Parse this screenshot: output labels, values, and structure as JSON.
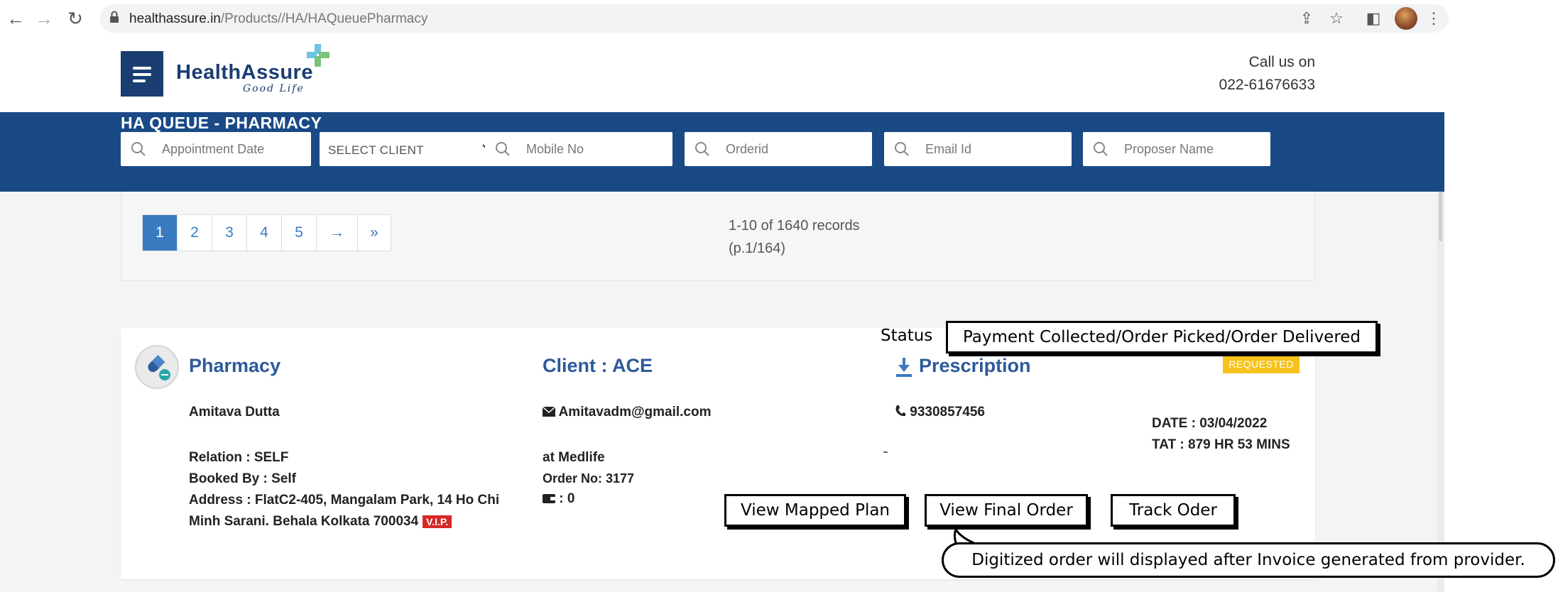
{
  "browser": {
    "url_host": "healthassure.in",
    "url_path": "/Products//HA/HAQueuePharmacy",
    "back_icon": "←",
    "forward_icon": "→",
    "reload_icon": "↻",
    "share_icon": "⇪",
    "star_icon": "☆",
    "sidepanel_icon": "◧",
    "more_icon": "⋮"
  },
  "header": {
    "logo_text": "HealthAssure",
    "logo_tagline": "Good Life",
    "call_label": "Call us on",
    "call_number": "022-61676633"
  },
  "banner": {
    "title": "HA QUEUE - PHARMACY",
    "filters": {
      "appointment_date": "Appointment Date",
      "select_client": "SELECT CLIENT",
      "mobile": "Mobile No",
      "orderid": "Orderid",
      "email": "Email Id",
      "proposer": "Proposer Name"
    }
  },
  "pagination": {
    "pages": [
      "1",
      "2",
      "3",
      "4",
      "5",
      "→",
      "»"
    ],
    "active": "1",
    "records_line1": "1-10 of 1640 records",
    "records_line2": "(p.1/164)"
  },
  "record": {
    "type_title": "Pharmacy",
    "client_title": "Client : ACE",
    "prescription_title": "Prescription",
    "status_badge": "REQUESTED",
    "name": "Amitava Dutta",
    "email": "Amitavadm@gmail.com",
    "phone": "9330857456",
    "relation": "Relation : SELF",
    "booked_by": "Booked By : Self",
    "address_line1": "Address : FlatC2-405, Mangalam Park, 14 Ho Chi",
    "address_line2": "Minh Sarani. Behala Kolkata 700034",
    "vip": "V.I.P.",
    "at": "at Medlife",
    "order_no": "Order No: 3177",
    "wallet": ": 0",
    "date": "DATE : 03/04/2022",
    "tat": "TAT : 879 HR 53 MINS",
    "dash": "-"
  },
  "annotations": {
    "status_label": "Status",
    "status_value": "Payment Collected/Order Picked/Order Delivered",
    "view_mapped_plan": "View Mapped Plan",
    "view_final_order": "View Final Order",
    "track_order": "Track Oder",
    "note": "Digitized order will displayed after Invoice generated from provider."
  },
  "colors": {
    "brand_navy": "#1a3d72",
    "banner_blue": "#1a4a86",
    "link_blue": "#3a7bc0",
    "requested_yellow": "#f6c21b",
    "vip_red": "#d62828"
  }
}
